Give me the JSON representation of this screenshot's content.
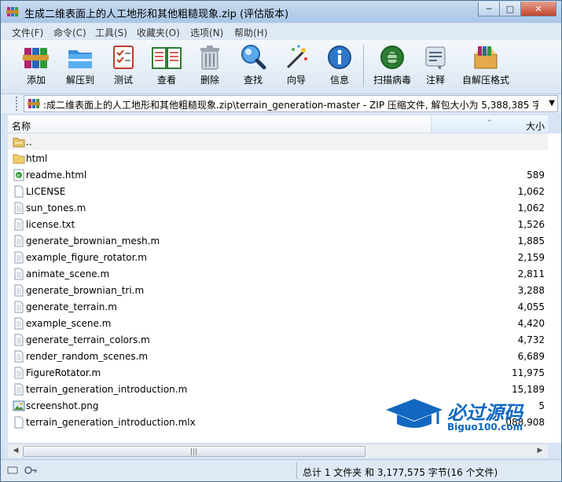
{
  "window": {
    "title": "生成二维表面上的人工地形和其他粗糙现象.zip (评估版本)",
    "controls": {
      "minimize": "─",
      "maximize": "□",
      "close": "✕"
    }
  },
  "menu": [
    "文件(F)",
    "命令(C)",
    "工具(S)",
    "收藏夹(O)",
    "选项(N)",
    "帮助(H)"
  ],
  "toolbar": [
    {
      "label": "添加",
      "icon": "books-icon"
    },
    {
      "label": "解压到",
      "icon": "folder-icon"
    },
    {
      "label": "测试",
      "icon": "checklist-icon"
    },
    {
      "label": "查看",
      "icon": "book-icon"
    },
    {
      "label": "删除",
      "icon": "trash-icon"
    },
    {
      "label": "查找",
      "icon": "magnifier-icon"
    },
    {
      "label": "向导",
      "icon": "wand-icon"
    },
    {
      "label": "信息",
      "icon": "info-icon"
    },
    {
      "label": "扫描病毒",
      "icon": "bug-icon"
    },
    {
      "label": "注释",
      "icon": "note-icon"
    },
    {
      "label": "自解压格式",
      "icon": "box-icon"
    }
  ],
  "address": {
    "path": ":成二维表面上的人工地形和其他粗糙现象.zip\\terrain_generation-master - ZIP 压缩文件, 解包大小为 5,388,385 字节"
  },
  "columns": {
    "name": "名称",
    "size": "大小"
  },
  "files": [
    {
      "name": "..",
      "size": "",
      "type": "folder-up"
    },
    {
      "name": "html",
      "size": "",
      "type": "folder"
    },
    {
      "name": "readme.html",
      "size": "589",
      "type": "html"
    },
    {
      "name": "LICENSE",
      "size": "1,062",
      "type": "blank"
    },
    {
      "name": "sun_tones.m",
      "size": "1,062",
      "type": "text"
    },
    {
      "name": "license.txt",
      "size": "1,526",
      "type": "text"
    },
    {
      "name": "generate_brownian_mesh.m",
      "size": "1,885",
      "type": "text"
    },
    {
      "name": "example_figure_rotator.m",
      "size": "2,159",
      "type": "text"
    },
    {
      "name": "animate_scene.m",
      "size": "2,811",
      "type": "text"
    },
    {
      "name": "generate_brownian_tri.m",
      "size": "3,288",
      "type": "text"
    },
    {
      "name": "generate_terrain.m",
      "size": "4,055",
      "type": "text"
    },
    {
      "name": "example_scene.m",
      "size": "4,420",
      "type": "text"
    },
    {
      "name": "generate_terrain_colors.m",
      "size": "4,732",
      "type": "text"
    },
    {
      "name": "render_random_scenes.m",
      "size": "6,689",
      "type": "text"
    },
    {
      "name": "FigureRotator.m",
      "size": "11,975",
      "type": "text"
    },
    {
      "name": "terrain_generation_introduction.m",
      "size": "15,189",
      "type": "text"
    },
    {
      "name": "screenshot.png",
      "size": "5",
      "type": "image"
    },
    {
      "name": "terrain_generation_introduction.mlx",
      "size": "088,908",
      "type": "blank"
    }
  ],
  "status": {
    "text": "总计 1 文件夹 和 3,177,575 字节(16 个文件)"
  },
  "watermark": {
    "cn": "必过源码",
    "en": "Biguo100.com"
  },
  "colors": {
    "accent": "#1268c0",
    "titlebar": "#b8d0ea"
  }
}
